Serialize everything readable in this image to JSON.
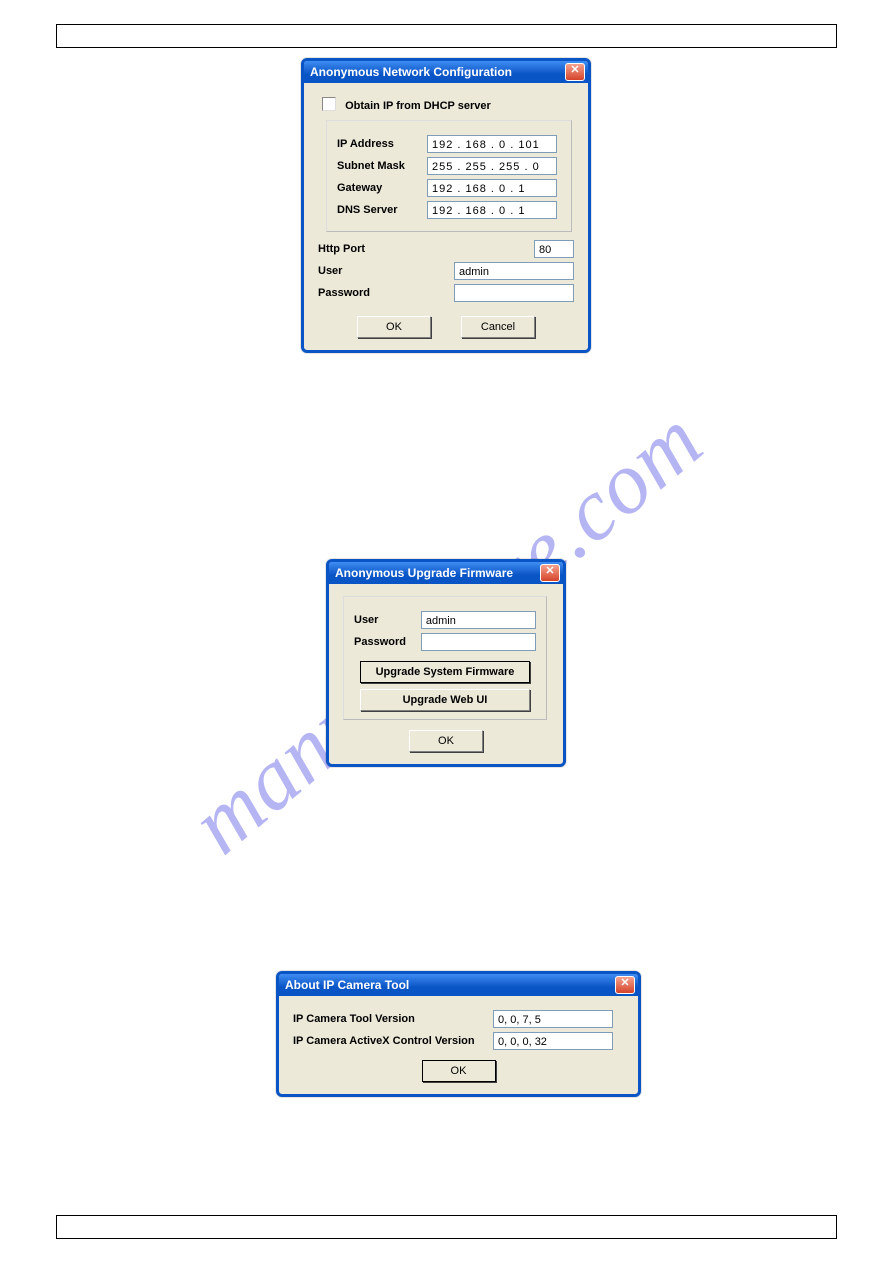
{
  "watermark": "manualchive.com",
  "dialog1": {
    "title": "Anonymous Network Configuration",
    "dhcp_label": "Obtain IP from DHCP server",
    "ip_label": "IP Address",
    "ip_value": "192 . 168 .  0  . 101",
    "subnet_label": "Subnet Mask",
    "subnet_value": "255 . 255 . 255 .  0",
    "gateway_label": "Gateway",
    "gateway_value": "192 . 168 .  0  .  1",
    "dns_label": "DNS Server",
    "dns_value": "192 . 168 .  0  .  1",
    "http_port_label": "Http Port",
    "http_port_value": "80",
    "user_label": "User",
    "user_value": "admin",
    "password_label": "Password",
    "password_value": "",
    "ok": "OK",
    "cancel": "Cancel"
  },
  "dialog2": {
    "title": "Anonymous Upgrade Firmware",
    "user_label": "User",
    "user_value": "admin",
    "password_label": "Password",
    "password_value": "",
    "btn_sys": "Upgrade System Firmware",
    "btn_web": "Upgrade Web UI",
    "ok": "OK"
  },
  "dialog3": {
    "title": "About IP Camera Tool",
    "tool_label": "IP Camera Tool Version",
    "tool_value": "0, 0, 7, 5",
    "activex_label": "IP Camera ActiveX Control Version",
    "activex_value": "0, 0, 0, 32",
    "ok": "OK"
  }
}
